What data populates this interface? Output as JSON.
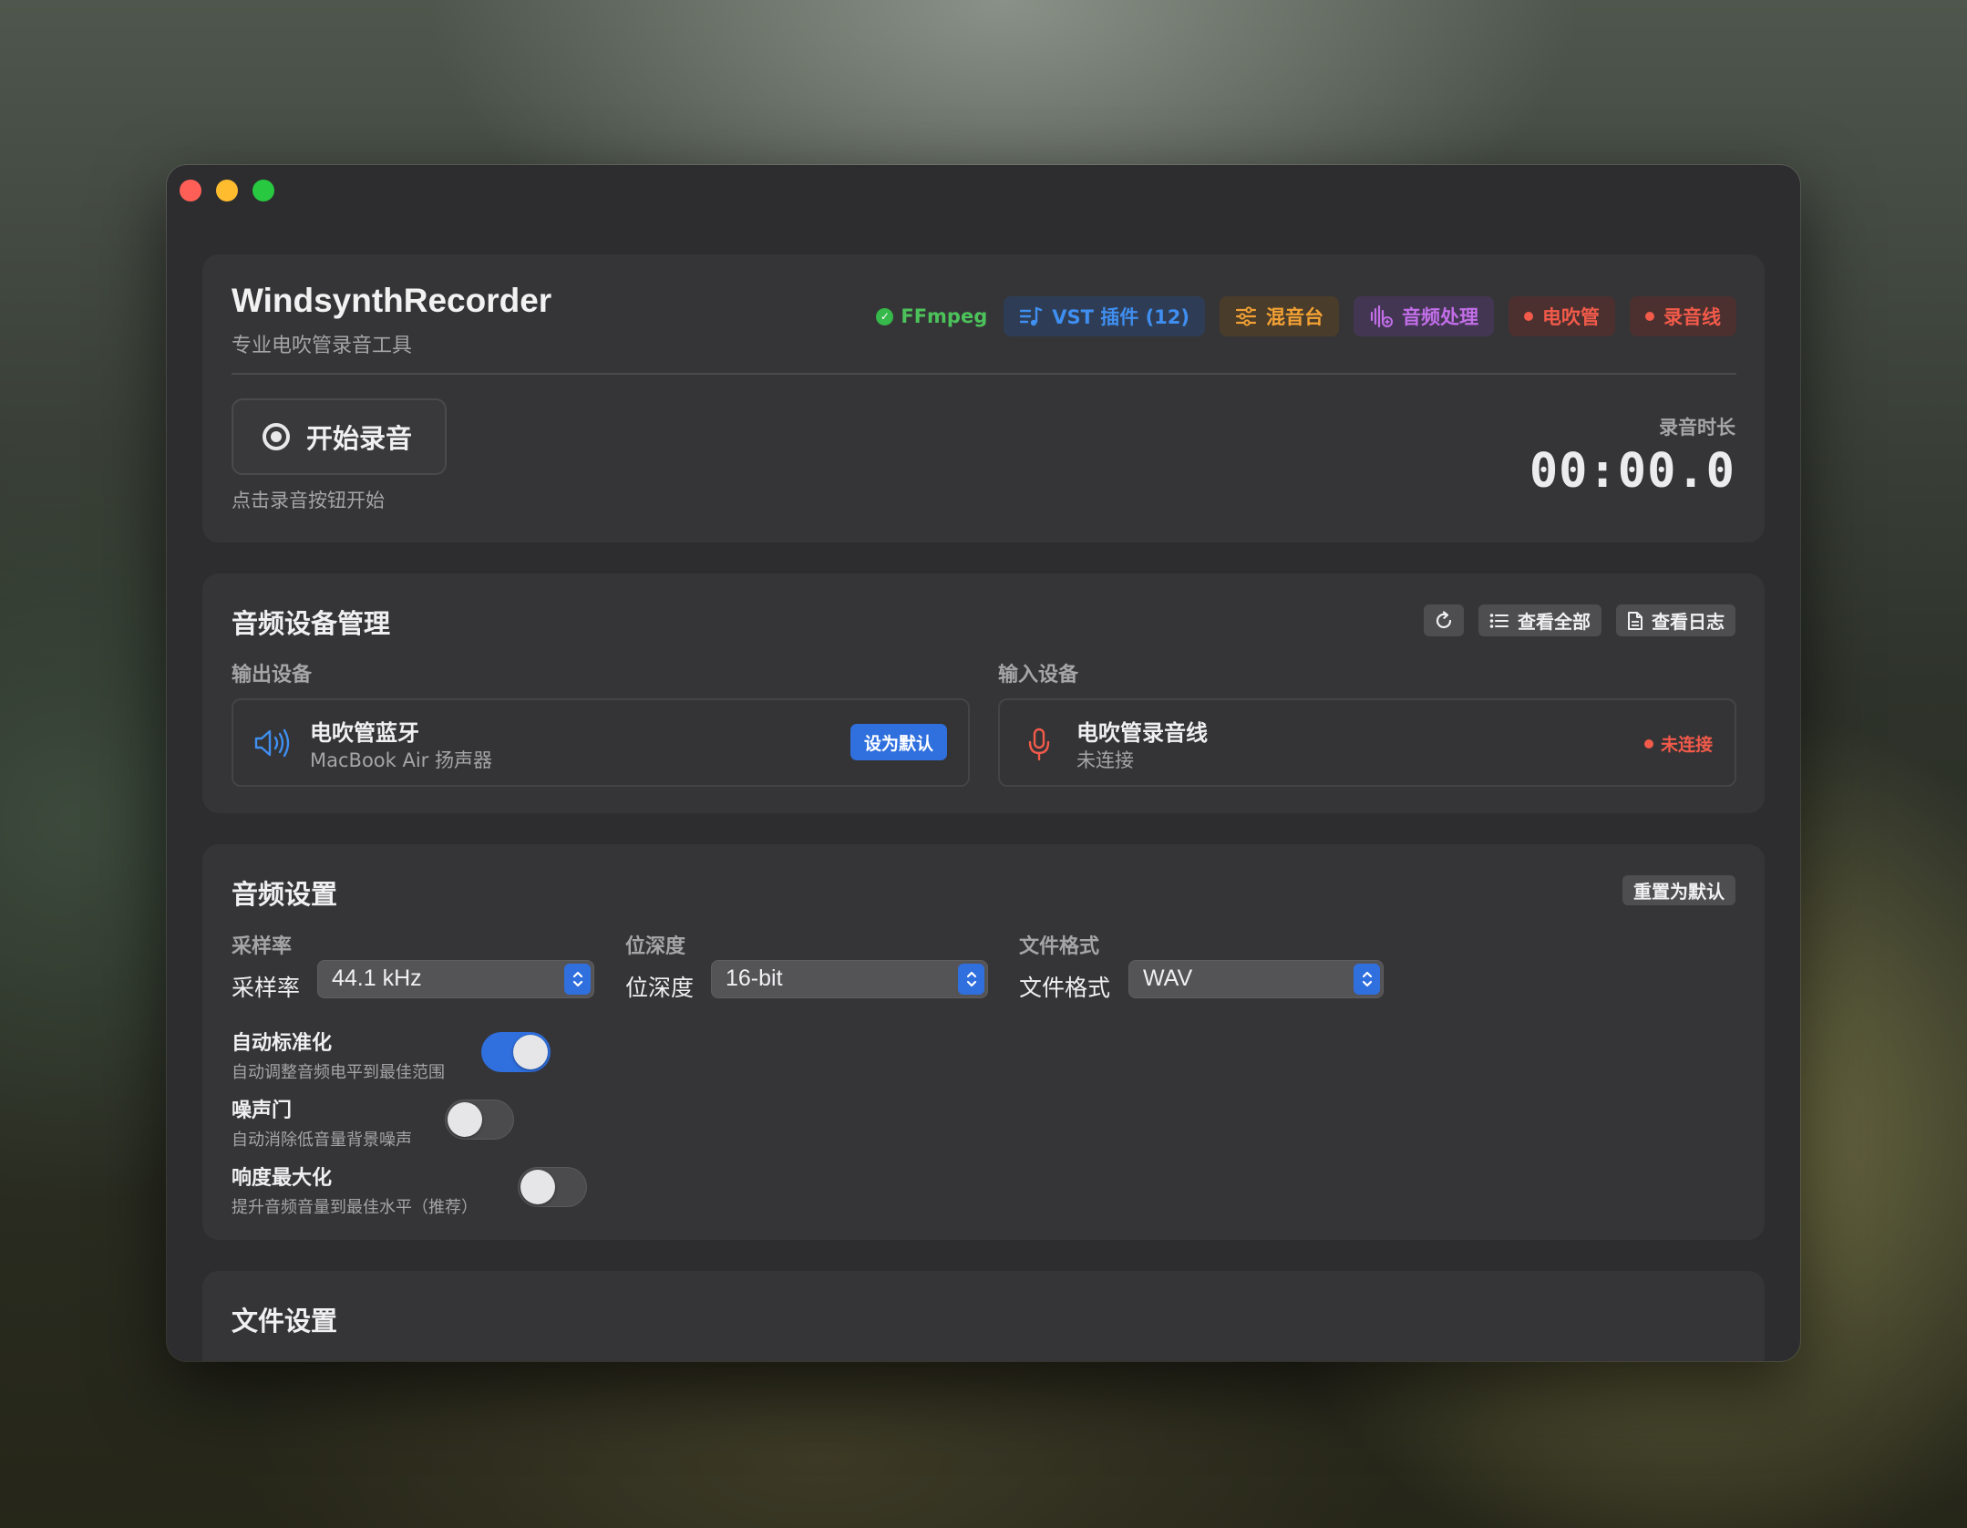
{
  "app": {
    "title": "WindsynthRecorder",
    "subtitle": "专业电吹管录音工具"
  },
  "status_badges": {
    "ffmpeg": "FFmpeg",
    "vst": "VST 插件 (12)",
    "mixer": "混音台",
    "processing": "音频处理",
    "windsynth": "电吹管",
    "cable": "录音线"
  },
  "recording": {
    "start_label": "开始录音",
    "hint": "点击录音按钮开始",
    "duration_label": "录音时长",
    "duration_value": "00:00.0"
  },
  "devices": {
    "title": "音频设备管理",
    "view_all": "查看全部",
    "view_log": "查看日志",
    "output": {
      "label": "输出设备",
      "name": "电吹管蓝牙",
      "detail": "MacBook Air 扬声器",
      "button": "设为默认"
    },
    "input": {
      "label": "输入设备",
      "name": "电吹管录音线",
      "detail": "未连接",
      "status": "未连接"
    }
  },
  "audio_settings": {
    "title": "音频设置",
    "reset": "重置为默认",
    "sample_rate": {
      "label": "采样率",
      "inline_label": "采样率",
      "value": "44.1 kHz"
    },
    "bit_depth": {
      "label": "位深度",
      "inline_label": "位深度",
      "value": "16-bit"
    },
    "file_format": {
      "label": "文件格式",
      "inline_label": "文件格式",
      "value": "WAV"
    },
    "toggles": [
      {
        "title": "自动标准化",
        "desc": "自动调整音频电平到最佳范围",
        "on": true
      },
      {
        "title": "噪声门",
        "desc": "自动消除低音量背景噪声",
        "on": false
      },
      {
        "title": "响度最大化",
        "desc": "提升音频音量到最佳水平（推荐）",
        "on": false
      }
    ]
  },
  "file_settings": {
    "title": "文件设置"
  },
  "colors": {
    "accent": "#2f6fde",
    "ok": "#36b94a",
    "error": "#f25a4a",
    "warning": "#f3a134",
    "purple": "#c26ee8"
  }
}
